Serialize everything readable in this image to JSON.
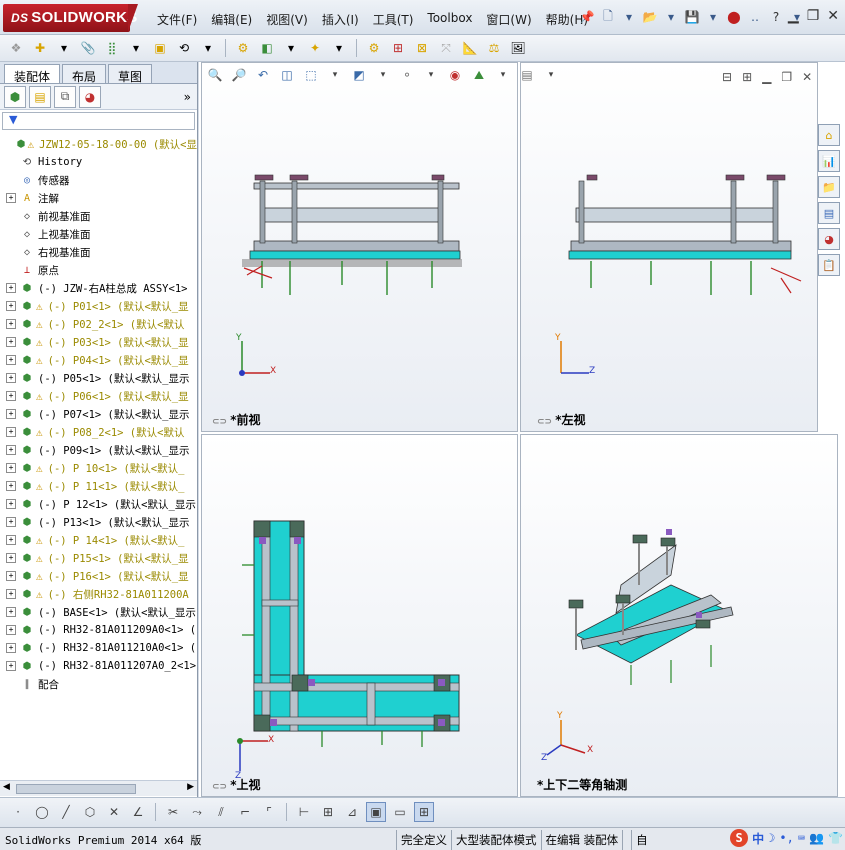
{
  "app": {
    "logo_prefix": "DS",
    "logo_text": "SOLIDWORKS"
  },
  "menu": [
    "文件(F)",
    "编辑(E)",
    "视图(V)",
    "插入(I)",
    "工具(T)",
    "Toolbox",
    "窗口(W)",
    "帮助(H)"
  ],
  "panel": {
    "tabs": [
      "装配体",
      "布局",
      "草图"
    ],
    "filter_label": "▼"
  },
  "tree": [
    {
      "label": "JZW12-05-18-00-00  (默认<显",
      "warn": true,
      "yellow": true,
      "expander": false,
      "icon": "assembly-icon"
    },
    {
      "label": "History",
      "warn": false,
      "yellow": false,
      "expander": false,
      "icon": "history-icon"
    },
    {
      "label": "传感器",
      "warn": false,
      "yellow": false,
      "expander": false,
      "icon": "sensor-icon"
    },
    {
      "label": "注解",
      "warn": false,
      "yellow": false,
      "expander": true,
      "icon": "annotation-icon"
    },
    {
      "label": "前视基准面",
      "warn": false,
      "yellow": false,
      "expander": false,
      "icon": "plane-icon"
    },
    {
      "label": "上视基准面",
      "warn": false,
      "yellow": false,
      "expander": false,
      "icon": "plane-icon"
    },
    {
      "label": "右视基准面",
      "warn": false,
      "yellow": false,
      "expander": false,
      "icon": "plane-icon"
    },
    {
      "label": "原点",
      "warn": false,
      "yellow": false,
      "expander": false,
      "icon": "origin-icon"
    },
    {
      "label": "(-) JZW-右A柱总成 ASSY<1>",
      "warn": false,
      "yellow": false,
      "expander": true,
      "icon": "subassembly-icon"
    },
    {
      "label": "(-) P01<1> (默认<默认_显",
      "warn": true,
      "yellow": true,
      "expander": true,
      "icon": "subassembly-icon"
    },
    {
      "label": "(-) P02_2<1> (默认<默认",
      "warn": true,
      "yellow": true,
      "expander": true,
      "icon": "subassembly-icon"
    },
    {
      "label": "(-) P03<1> (默认<默认_显",
      "warn": true,
      "yellow": true,
      "expander": true,
      "icon": "subassembly-icon"
    },
    {
      "label": "(-) P04<1> (默认<默认_显",
      "warn": true,
      "yellow": true,
      "expander": true,
      "icon": "subassembly-icon"
    },
    {
      "label": "(-) P05<1> (默认<默认_显示",
      "warn": false,
      "yellow": false,
      "expander": true,
      "icon": "subassembly-icon"
    },
    {
      "label": "(-) P06<1> (默认<默认_显",
      "warn": true,
      "yellow": true,
      "expander": true,
      "icon": "subassembly-icon"
    },
    {
      "label": "(-) P07<1> (默认<默认_显示",
      "warn": false,
      "yellow": false,
      "expander": true,
      "icon": "subassembly-icon"
    },
    {
      "label": "(-) P08_2<1> (默认<默认",
      "warn": true,
      "yellow": true,
      "expander": true,
      "icon": "subassembly-icon"
    },
    {
      "label": "(-) P09<1> (默认<默认_显示",
      "warn": false,
      "yellow": false,
      "expander": true,
      "icon": "subassembly-icon"
    },
    {
      "label": "(-) P 10<1> (默认<默认_",
      "warn": true,
      "yellow": true,
      "expander": true,
      "icon": "subassembly-icon"
    },
    {
      "label": "(-) P 11<1> (默认<默认_",
      "warn": true,
      "yellow": true,
      "expander": true,
      "icon": "subassembly-icon"
    },
    {
      "label": "(-) P 12<1> (默认<默认_显示",
      "warn": false,
      "yellow": false,
      "expander": true,
      "icon": "subassembly-icon"
    },
    {
      "label": "(-) P13<1> (默认<默认_显示",
      "warn": false,
      "yellow": false,
      "expander": true,
      "icon": "subassembly-icon"
    },
    {
      "label": "(-) P 14<1> (默认<默认_",
      "warn": true,
      "yellow": true,
      "expander": true,
      "icon": "subassembly-icon"
    },
    {
      "label": "(-) P15<1> (默认<默认_显",
      "warn": true,
      "yellow": true,
      "expander": true,
      "icon": "subassembly-icon"
    },
    {
      "label": "(-) P16<1> (默认<默认_显",
      "warn": true,
      "yellow": true,
      "expander": true,
      "icon": "subassembly-icon"
    },
    {
      "label": "(-) 右侧RH32-81A011200A",
      "warn": true,
      "yellow": true,
      "expander": true,
      "icon": "subassembly-icon"
    },
    {
      "label": "(-) BASE<1> (默认<默认_显示",
      "warn": false,
      "yellow": false,
      "expander": true,
      "icon": "subassembly-icon"
    },
    {
      "label": "(-) RH32-81A011209A0<1> (",
      "warn": false,
      "yellow": false,
      "expander": true,
      "icon": "subassembly-icon"
    },
    {
      "label": "(-) RH32-81A011210A0<1> (",
      "warn": false,
      "yellow": false,
      "expander": true,
      "icon": "subassembly-icon"
    },
    {
      "label": "(-) RH32-81A011207A0_2<1>",
      "warn": false,
      "yellow": false,
      "expander": true,
      "icon": "subassembly-icon"
    },
    {
      "label": "配合",
      "warn": false,
      "yellow": false,
      "expander": false,
      "icon": "mates-icon"
    }
  ],
  "views": {
    "front": "*前视",
    "left": "*左视",
    "top": "*上视",
    "iso": "*上下二等角轴测"
  },
  "axes": {
    "x": "X",
    "y": "Y",
    "z": "Z"
  },
  "status": {
    "left": "SolidWorks Premium 2014 x64 版",
    "cells": [
      "完全定义",
      "大型装配体模式",
      "在编辑 装配体",
      "",
      "自"
    ],
    "ime_s": "S",
    "ime_lang": "中"
  },
  "colors": {
    "brand_red": "#c8232c",
    "frame_teal": "#1fd0d0",
    "frame_gray": "#9aa4ad",
    "warning_yellow": "#c89400"
  }
}
